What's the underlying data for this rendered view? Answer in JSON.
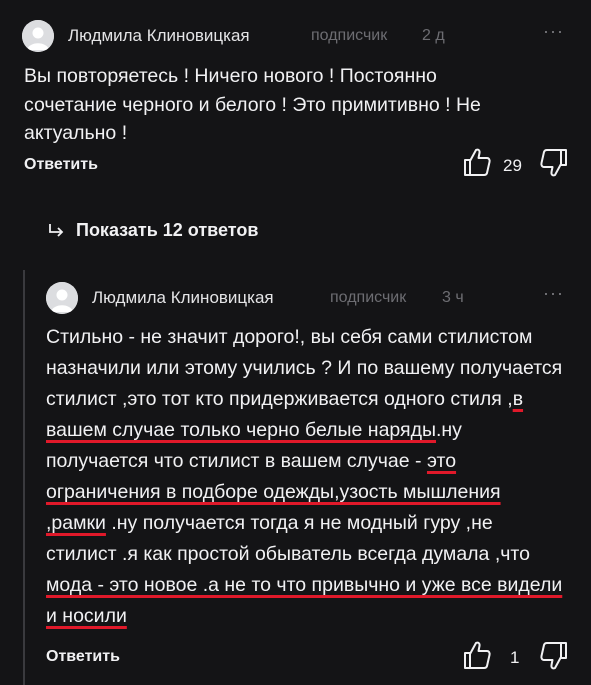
{
  "comments": [
    {
      "author": "Людмила Клиновицкая",
      "role": "подписчик",
      "time": "2 д",
      "lines": [
        "Вы повторяетесь ! Ничего нового ! Постоянно",
        "сочетание черного и белого ! Это примитивно ! Не",
        "актуально !"
      ],
      "reply_label": "Ответить",
      "likes": "29"
    },
    {
      "author": "Людмила Клиновицкая",
      "role": "подписчик",
      "time": "3 ч",
      "text_parts": [
        "Стильно - не значит дорого!, вы себя сами стилистом назначили или этому учились ? И по вашему получается стилист ,это тот кто придерживается одного стиля ,",
        "в вашем случае только черно белые наряды",
        ".ну получается что стилист в вашем случае - ",
        "это ограничения в подборе одежды,узость мышления ,рамки",
        " .ну получается тогда я не модный гуру ,не стилист .я как простой обыватель всегда думала ,что ",
        "мода - это новое .а не то что привычно и уже все видели и носили"
      ],
      "reply_label": "Ответить",
      "likes": "1"
    }
  ],
  "show_replies_label": "Показать 12 ответов",
  "colors": {
    "background": "#141416",
    "underline": "#e0192a",
    "muted": "#6d6d72"
  },
  "icons": [
    "avatar-user-icon",
    "more-dots-icon",
    "thumbs-up-icon",
    "thumbs-down-icon",
    "reply-arrow-icon"
  ]
}
